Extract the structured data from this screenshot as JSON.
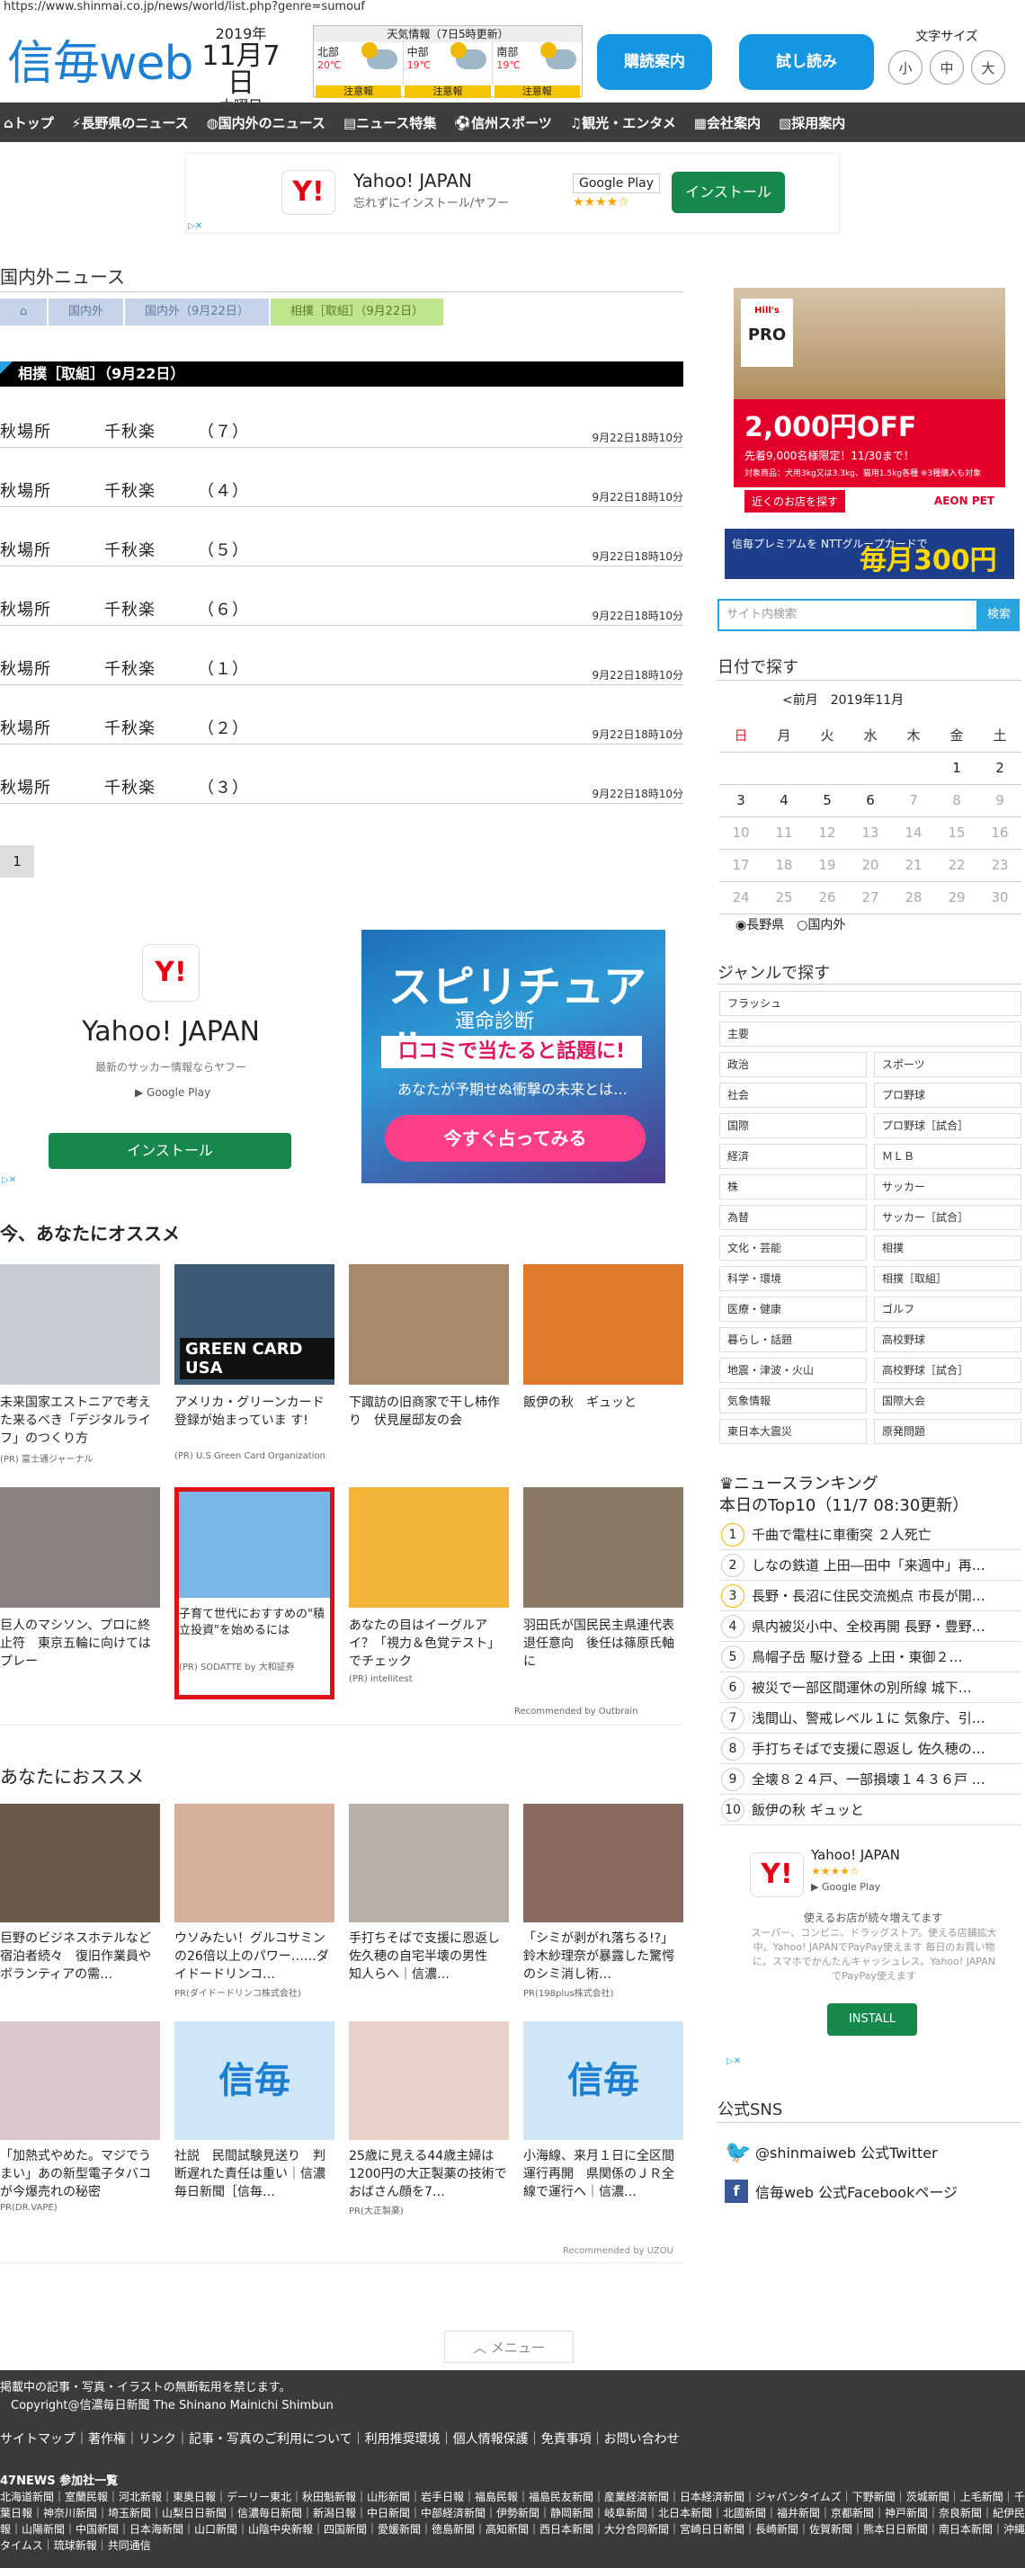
{
  "url": "https://www.shinmai.co.jp/news/world/list.php?genre=sumouf",
  "logo": {
    "a": "信毎",
    "b": "web"
  },
  "date": {
    "year": "2019年",
    "day": "11月7日",
    "weekday": "木曜日"
  },
  "weather": {
    "title": "天気情報（7日5時更新）",
    "regions": [
      {
        "name": "北部",
        "temp": "20℃",
        "warn": "注意報"
      },
      {
        "name": "中部",
        "temp": "19℃",
        "warn": "注意報"
      },
      {
        "name": "南部",
        "temp": "19℃",
        "warn": "注意報"
      }
    ]
  },
  "header": {
    "subscribe": "購読案内",
    "trial": "試し読み",
    "font_size_label": "文字サイズ",
    "font_sizes": [
      "小",
      "中",
      "大"
    ]
  },
  "nav": [
    "トップ",
    "長野県のニュース",
    "国内外のニュース",
    "ニュース特集",
    "信州スポーツ",
    "観光・エンタメ",
    "会社案内",
    "採用案内"
  ],
  "ad_top": {
    "name": "Yahoo! JAPAN",
    "sub": "忘れずにインストール/ヤフー",
    "store": "Google Play",
    "stars": "★★★★☆",
    "install": "インストール"
  },
  "section_title": "国内外ニュース",
  "breadcrumb": [
    "国内外",
    "国内外（9月22日）",
    "相撲［取組］（9月22日）"
  ],
  "category_bar": "相撲［取組］（9月22日）",
  "news": [
    {
      "a": "秋場所",
      "b": "千秋楽",
      "c": "（７）",
      "time": "9月22日18時10分"
    },
    {
      "a": "秋場所",
      "b": "千秋楽",
      "c": "（４）",
      "time": "9月22日18時10分"
    },
    {
      "a": "秋場所",
      "b": "千秋楽",
      "c": "（５）",
      "time": "9月22日18時10分"
    },
    {
      "a": "秋場所",
      "b": "千秋楽",
      "c": "（６）",
      "time": "9月22日18時10分"
    },
    {
      "a": "秋場所",
      "b": "千秋楽",
      "c": "（１）",
      "time": "9月22日18時10分"
    },
    {
      "a": "秋場所",
      "b": "千秋楽",
      "c": "（２）",
      "time": "9月22日18時10分"
    },
    {
      "a": "秋場所",
      "b": "千秋楽",
      "c": "（３）",
      "time": "9月22日18時10分"
    }
  ],
  "pager": "1",
  "ad_mid": {
    "name": "Yahoo! JAPAN",
    "sub": "最新のサッカー情報ならヤフー",
    "store": "Google Play",
    "install": "インストール"
  },
  "ad_spiritual": {
    "a": "スピリチュアル",
    "b": "運命診断",
    "c": "口コミで当たると話題に!",
    "d": "あなたが予期せぬ衝撃の未来とは…",
    "e": "今すぐ占ってみる"
  },
  "reco_title": "今、あなたにオススメ",
  "reco": [
    {
      "cap": "未来国家エストニアで考えた来るべき「デジタルライフ」のつくり方",
      "src": "(PR) 富士通ジャーナル",
      "color": "#c8ccd4"
    },
    {
      "cap": "アメリカ・グリーンカード登録が始まっていま す!",
      "src": "(PR) U.S Green Card Organization",
      "color": "#3b5a76"
    },
    {
      "cap": "下諏訪の旧商家で干し柿作り　伏見屋邸友の会",
      "src": "",
      "color": "#a88a6a"
    },
    {
      "cap": "飯伊の秋　ギュッと",
      "src": "",
      "color": "#e07a2a"
    },
    {
      "cap": "巨人のマシソン、プロに終止符　東京五輪に向けてはプレー",
      "src": "",
      "color": "#8a8080"
    },
    {
      "cap": "子育て世代におすすめの\"積立投資\"を始めるには",
      "src": "(PR) SODATTE by 大和証券",
      "color": "#7ab6e6"
    },
    {
      "cap": "あなたの目はイーグルアイ？「視力＆色覚テスト」でチェック",
      "src": "(PR) intellitest",
      "color": "#f2b53a"
    },
    {
      "cap": "羽田氏が国民民主県連代表退任意向　後任は篠原氏軸に",
      "src": "",
      "color": "#8a7a66"
    }
  ],
  "reco_by": "Recommended by Outbrain",
  "you_title": "あなたにおススメ",
  "you": [
    {
      "cap": "巨野のビジネスホテルなど宿泊者続々　復旧作業員やボランティアの需…",
      "src": "",
      "color": "#6a5a4a"
    },
    {
      "cap": "ウソみたい！グルコサミンの26倍以上のパワー……ダイドードリンコ…",
      "src": "PR(ダイドードリンコ株式会社)",
      "color": "#d6b09a"
    },
    {
      "cap": "手打ちそばで支援に恩返し　佐久穂の自宅半壊の男性　知人らへ｜信濃…",
      "src": "",
      "color": "#b8b0a6"
    },
    {
      "cap": "「シミが剥がれ落ちる!?」鈴木紗理奈が暴露した驚愕のシミ消し術…",
      "src": "PR(198plus株式会社)",
      "color": "#8a6a60"
    },
    {
      "cap": "「加熱式やめた。マジでうまい」あの新型電子タバコが今爆売れの秘密",
      "src": "PR(DR.VAPE)",
      "color": "#d8c8cc"
    },
    {
      "cap": "社説　民間試験見送り　判断遅れた責任は重い｜信濃毎日新聞［信毎…",
      "src": "",
      "color": "#cfe6f6"
    },
    {
      "cap": "25歳に見える44歳主婦は1200円の大正製薬の技術でおばさん顔を7…",
      "src": "PR(大正製薬)",
      "color": "#e8d2c8"
    },
    {
      "cap": "小海線、来月１日に全区間運行再開　県関係のＪＲ全線で運行へ｜信濃…",
      "src": "",
      "color": "#cfe6f6"
    }
  ],
  "you_by": "Recommended by UZOU",
  "menu_btn": "メニュー",
  "side_ad": {
    "brand": "Hill's",
    "pro": "PRO",
    "price": "2,000円OFF",
    "note": "先着9,000名様限定！11/30まで！",
    "small": "対象商品：犬用3kg又は3.3kg、猫用1.5kg各種 ※3種購入も対象",
    "shop": "近くのお店を探す",
    "store": "AEON PET"
  },
  "premium": {
    "a": "信毎プレミアムを NTTグループカードで",
    "b": "毎月300円"
  },
  "search": {
    "placeholder": "サイト内検索",
    "button": "検索"
  },
  "cal_title": "日付で探す",
  "cal_nav": {
    "prev": "<前月",
    "month": "2019年11月"
  },
  "cal_head": [
    "日",
    "月",
    "火",
    "水",
    "木",
    "金",
    "土"
  ],
  "cal_rows": [
    [
      "",
      "",
      "",
      "",
      "",
      "1",
      "2"
    ],
    [
      "3",
      "4",
      "5",
      "6",
      "7",
      "8",
      "9"
    ],
    [
      "10",
      "11",
      "12",
      "13",
      "14",
      "15",
      "16"
    ],
    [
      "17",
      "18",
      "19",
      "20",
      "21",
      "22",
      "23"
    ],
    [
      "24",
      "25",
      "26",
      "27",
      "28",
      "29",
      "30"
    ]
  ],
  "cal_radio": [
    "長野県",
    "国内外"
  ],
  "genre_title": "ジャンルで探す",
  "genres_full": [
    "フラッシュ",
    "主要"
  ],
  "genres": [
    "政治",
    "スポーツ",
    "社会",
    "プロ野球",
    "国際",
    "プロ野球［試合］",
    "経済",
    "ＭＬＢ",
    "株",
    "サッカー",
    "為替",
    "サッカー［試合］",
    "文化・芸能",
    "相撲",
    "科学・環境",
    "相撲［取組］",
    "医療・健康",
    "ゴルフ",
    "暮らし・話題",
    "高校野球",
    "地震・津波・火山",
    "高校野球［試合］",
    "気象情報",
    "国際大会",
    "東日本大震災",
    "原発問題"
  ],
  "ranking": {
    "title": "ニュースランキング",
    "sub": "本日のTop10（11/7 08:30更新）",
    "items": [
      "千曲で電柱に車衝突 ２人死亡",
      "しなの鉄道 上田―田中「来週中」再…",
      "長野・長沼に住民交流拠点 市長が開…",
      "県内被災小中、全校再開 長野・豊野…",
      "鳥帽子岳 駆け登る 上田・東御２…",
      "被災で一部区間運休の別所線 城下…",
      "浅間山、警戒レベル１に 気象庁、引…",
      "手打ちそばで支援に恩返し 佐久穂の…",
      "全壊８２４戸、一部損壊１４３６戸 …",
      "飯伊の秋 ギュッと"
    ]
  },
  "ad_side2": {
    "name": "Yahoo! JAPAN",
    "stars": "★★★★☆",
    "store": "Google Play",
    "sub": "使えるお店が続々増えてます",
    "desc": "スーパー、コンビニ、ドラッグストア。使える店舗拡大中。Yahoo! JAPANでPayPay使えます 毎日のお買い物に。スマホでかんたんキャッシュレス。Yahoo! JAPANでPayPay使えます",
    "install": "INSTALL"
  },
  "sns_title": "公式SNS",
  "sns": [
    "@shinmaiweb 公式Twitter",
    "信毎web 公式Facebookページ"
  ],
  "footer": {
    "l1": "掲載中の記事・写真・イラストの無断転用を禁じます。",
    "l2": "Copyright@信濃毎日新聞 The Shinano Mainichi Shimbun",
    "links": "サイトマップ｜著作権｜リンク｜記事・写真のご利用について｜利用推奨環境｜個人情報保護｜免責事項｜お問い合わせ",
    "l3": "47NEWS 参加社一覧",
    "papers": "北海道新聞｜室蘭民報｜河北新報｜東奥日報｜デーリー東北｜秋田魁新報｜山形新聞｜岩手日報｜福島民報｜福島民友新聞｜産業経済新聞｜日本経済新聞｜ジャパンタイムズ｜下野新聞｜茨城新聞｜上毛新聞｜千葉日報｜神奈川新聞｜埼玉新聞｜山梨日日新聞｜信濃毎日新聞｜新潟日報｜中日新聞｜中部経済新聞｜伊勢新聞｜静岡新聞｜岐阜新聞｜北日本新聞｜北國新聞｜福井新聞｜京都新聞｜神戸新聞｜奈良新聞｜紀伊民報｜山陽新聞｜中国新聞｜日本海新聞｜山口新聞｜山陰中央新報｜四国新聞｜愛媛新聞｜徳島新聞｜高知新聞｜西日本新聞｜大分合同新聞｜宮崎日日新聞｜長崎新聞｜佐賀新聞｜熊本日日新聞｜南日本新聞｜沖縄タイムス｜琉球新報｜共同通信"
  }
}
